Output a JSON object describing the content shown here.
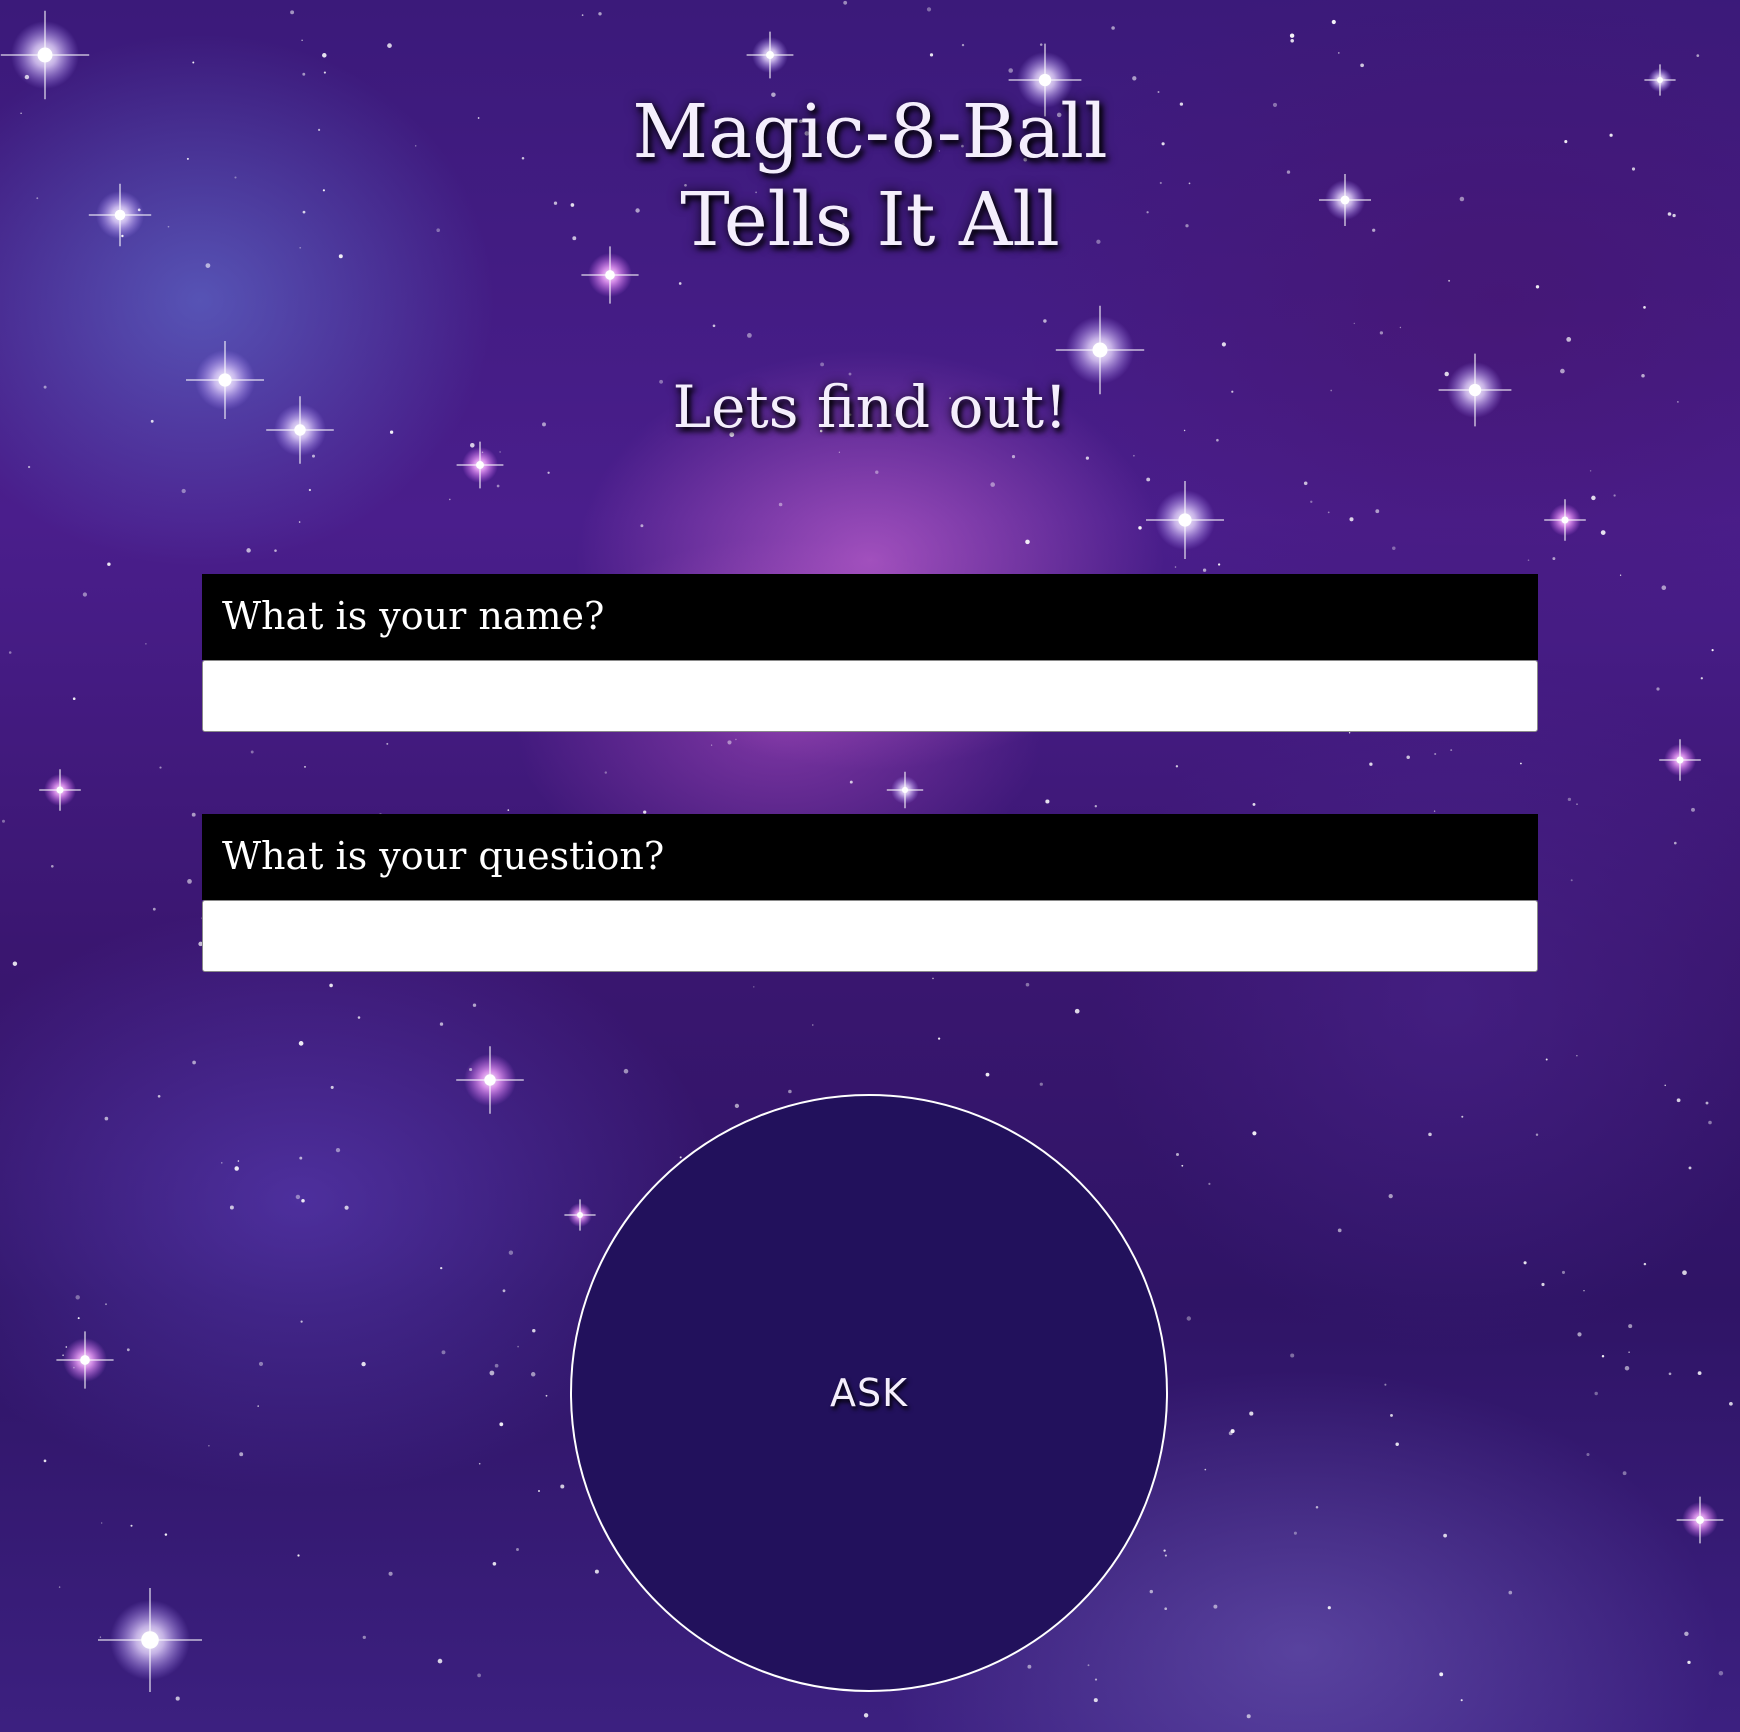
{
  "header": {
    "title_line1": "Magic-8-Ball",
    "title_line2": "Tells It All",
    "subtitle": "Lets find out!"
  },
  "form": {
    "name_label": "What is your name?",
    "name_value": "",
    "question_label": "What is your question?",
    "question_value": ""
  },
  "ask_button": {
    "label": "ASK"
  },
  "colors": {
    "ball_fill": "#22115c",
    "label_background": "#000000",
    "text": "#f4eefc"
  }
}
